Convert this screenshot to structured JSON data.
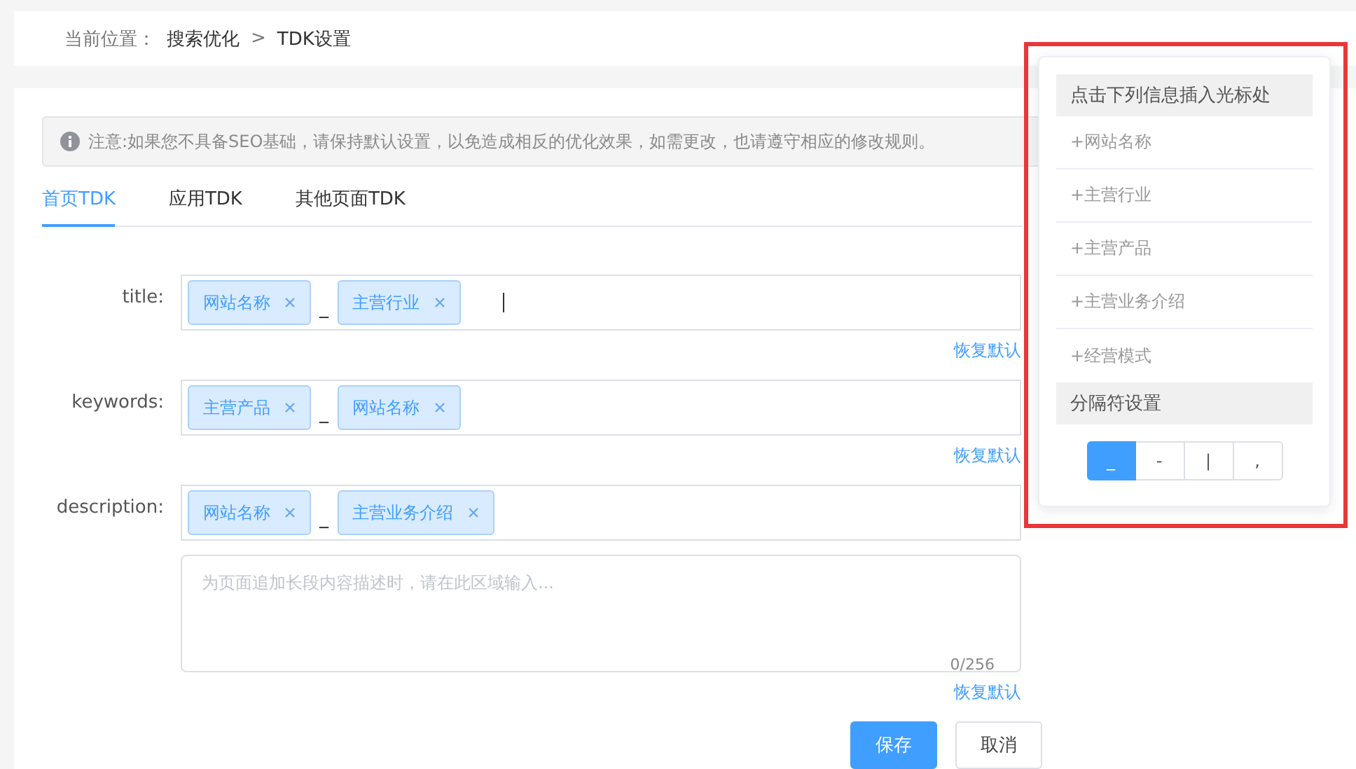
{
  "breadcrumb": {
    "label": "当前位置：",
    "items": [
      "搜索优化",
      "TDK设置"
    ],
    "separator": ">"
  },
  "notice": "注意:如果您不具备SEO基础，请保持默认设置，以免造成相反的优化效果，如需更改，也请遵守相应的修改规则。",
  "tabs": [
    {
      "label": "首页TDK",
      "selected": true
    },
    {
      "label": "应用TDK",
      "selected": false
    },
    {
      "label": "其他页面TDK",
      "selected": false
    }
  ],
  "fields": [
    {
      "label": "title:",
      "tags": [
        "网站名称",
        "主营行业"
      ],
      "separator": "_",
      "cursor": true,
      "reset": "恢复默认"
    },
    {
      "label": "keywords:",
      "tags": [
        "主营产品",
        "网站名称"
      ],
      "separator": "_",
      "cursor": false,
      "reset": "恢复默认"
    },
    {
      "label": "description:",
      "tags": [
        "网站名称",
        "主营业务介绍"
      ],
      "separator": "_",
      "cursor": false,
      "textarea": {
        "placeholder": "为页面追加长段内容描述时，请在此区域输入...",
        "count": "0/256"
      },
      "reset": "恢复默认"
    }
  ],
  "buttons": {
    "save": "保存",
    "cancel": "取消"
  },
  "popover": {
    "title": "点击下列信息插入光标处",
    "items": [
      "+网站名称",
      "+主营行业",
      "+主营产品",
      "+主营业务介绍",
      "+经营模式"
    ],
    "separator_title": "分隔符设置",
    "separators": [
      {
        "label": "_",
        "selected": true
      },
      {
        "label": "-",
        "selected": false
      },
      {
        "label": "|",
        "selected": false
      },
      {
        "label": ",",
        "selected": false
      }
    ]
  }
}
